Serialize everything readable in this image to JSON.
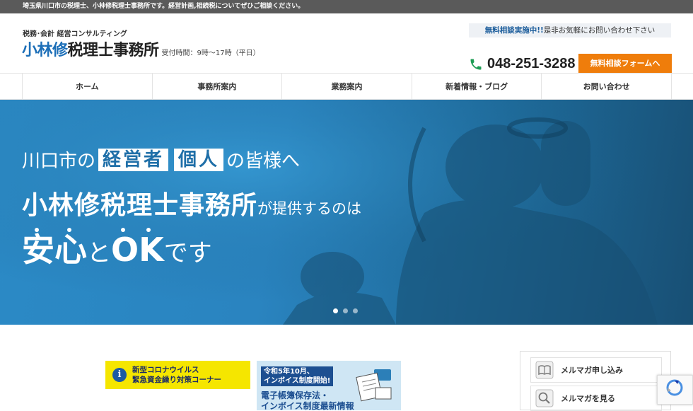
{
  "topbar": {
    "text": "埼玉県川口市の税理士、小林修税理士事務所です。経営計画,相続税についてぜひご相談ください。"
  },
  "header": {
    "tagline": "税務･会計 経営コンサルティング",
    "logo_part1": "小林修",
    "logo_part2": "税理士事務所",
    "hours": "受付時間：9時～17時（平日）",
    "notice_strong": "無料相談実施中!!",
    "notice_rest": "是非お気軽にお問い合わせ下さい",
    "phone": "048-251-3288",
    "cta_label": "無料相談フォームへ"
  },
  "nav": {
    "items": [
      {
        "label": "ホーム"
      },
      {
        "label": "事務所案内"
      },
      {
        "label": "業務案内"
      },
      {
        "label": "新着情報・ブログ"
      },
      {
        "label": "お問い合わせ"
      }
    ]
  },
  "hero": {
    "line1_pre": "川口市の",
    "line1_box1": "経営者",
    "line1_box2": "個人",
    "line1_post": "の皆様へ",
    "line2_big": "小林修税理士事務所",
    "line2_small": "が提供するのは",
    "line3_a": "安心",
    "line3_b": "と",
    "line3_c": "OK",
    "line3_d": "です",
    "slides": 3,
    "active_slide": 1
  },
  "banners": {
    "corona_line1": "新型コロナウイルス",
    "corona_line2": "緊急資金繰り対策コーナー",
    "invoice_tag1": "令和5年10月、",
    "invoice_tag2": "インボイス制度開始!",
    "invoice_main1": "電子帳簿保存法・",
    "invoice_main2": "インボイス制度最新情報"
  },
  "sidebar": {
    "items": [
      {
        "label": "メルマガ申し込み",
        "icon": "book-icon"
      },
      {
        "label": "メルマガを見る",
        "icon": "magnifier-icon"
      }
    ]
  },
  "colors": {
    "accent": "#1d6fb8",
    "cta": "#ef7d0b",
    "notice_bg": "#eef1f5"
  }
}
